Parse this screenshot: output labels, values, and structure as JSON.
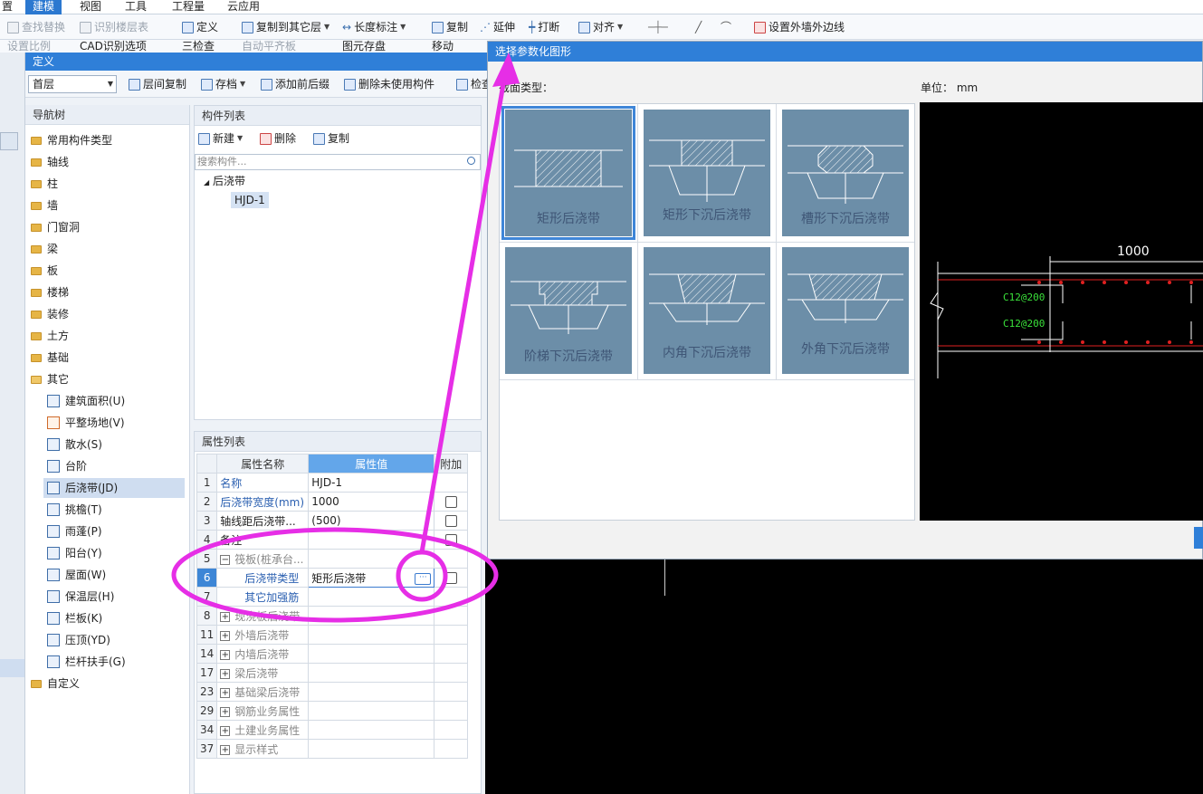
{
  "menu": {
    "items": [
      "置",
      "建模",
      "视图",
      "工具",
      "工程量",
      "云应用"
    ],
    "active": "建模"
  },
  "ribbon": {
    "find_replace": "查找替换",
    "recognize_floor_table": "识别楼层表",
    "define": "定义",
    "copy_to_other_floor": "复制到其它层",
    "length_dim": "长度标注",
    "copy": "复制",
    "extend": "延伸",
    "break": "打断",
    "align": "对齐",
    "set_outer_wall_edge": "设置外墙外边线",
    "row2_a": "设置比例",
    "row2_b": "CAD识别选项",
    "row2_c": "三检查",
    "row2_d": "自动平齐板",
    "row2_e": "图元存盘",
    "row2_f": "移动"
  },
  "define_window": {
    "title": "定义",
    "floor": "首层",
    "toolbar": {
      "floor_copy": "层间复制",
      "save": "存档",
      "add_prefix_suffix": "添加前后缀",
      "delete_unused": "删除未使用构件",
      "check": "检查"
    }
  },
  "nav_tree": {
    "title": "导航树",
    "folders": [
      "常用构件类型",
      "轴线",
      "柱",
      "墙",
      "门窗洞",
      "梁",
      "板",
      "楼梯",
      "装修",
      "土方",
      "基础",
      "其它"
    ],
    "other_children": [
      "建筑面积(U)",
      "平整场地(V)",
      "散水(S)",
      "台阶",
      "后浇带(JD)",
      "挑檐(T)",
      "雨蓬(P)",
      "阳台(Y)",
      "屋面(W)",
      "保温层(H)",
      "栏板(K)",
      "压顶(YD)",
      "栏杆扶手(G)"
    ],
    "selected": "后浇带(JD)",
    "custom": "自定义"
  },
  "component_list": {
    "title": "构件列表",
    "new": "新建",
    "delete": "删除",
    "copy": "复制",
    "search_placeholder": "搜索构件...",
    "group": "后浇带",
    "items": [
      "HJD-1"
    ]
  },
  "property_list": {
    "title": "属性列表",
    "headers": [
      "属性名称",
      "属性值",
      "附加"
    ],
    "rows": [
      {
        "num": "1",
        "name": "名称",
        "value": "HJD-1",
        "style": "blue",
        "check": false
      },
      {
        "num": "2",
        "name": "后浇带宽度(mm)",
        "value": "1000",
        "style": "blue",
        "check": true
      },
      {
        "num": "3",
        "name": "轴线距后浇带...",
        "value": "(500)",
        "style": "",
        "check": true
      },
      {
        "num": "4",
        "name": "备注",
        "value": "",
        "style": "",
        "check": true
      },
      {
        "num": "5",
        "name": "筏板(桩承台...",
        "value": "",
        "style": "gray-minus",
        "check": false
      },
      {
        "num": "6",
        "name": "后浇带类型",
        "value": "矩形后浇带",
        "style": "blue-indent",
        "check": true
      },
      {
        "num": "7",
        "name": "其它加强筋",
        "value": "",
        "style": "blue-indent",
        "check": false
      },
      {
        "num": "8",
        "name": "现浇板后浇带",
        "value": "",
        "style": "gray-plus",
        "check": false
      },
      {
        "num": "11",
        "name": "外墙后浇带",
        "value": "",
        "style": "gray-plus",
        "check": false
      },
      {
        "num": "14",
        "name": "内墙后浇带",
        "value": "",
        "style": "gray-plus",
        "check": false
      },
      {
        "num": "17",
        "name": "梁后浇带",
        "value": "",
        "style": "gray-plus",
        "check": false
      },
      {
        "num": "23",
        "name": "基础梁后浇带",
        "value": "",
        "style": "gray-plus",
        "check": false
      },
      {
        "num": "29",
        "name": "钢筋业务属性",
        "value": "",
        "style": "gray-plus",
        "check": false
      },
      {
        "num": "34",
        "name": "土建业务属性",
        "value": "",
        "style": "gray-plus",
        "check": false
      },
      {
        "num": "37",
        "name": "显示样式",
        "value": "",
        "style": "gray-plus",
        "check": false
      }
    ],
    "selected_row": "6"
  },
  "param_dialog": {
    "title": "选择参数化图形",
    "section_type_label": "截面类型：",
    "unit_label": "单位：",
    "unit_value": "mm",
    "shapes": [
      "矩形后浇带",
      "矩形下沉后浇带",
      "槽形下沉后浇带",
      "阶梯下沉后浇带",
      "内角下沉后浇带",
      "外角下沉后浇带"
    ],
    "selected_shape": "矩形后浇带",
    "preview": {
      "dimension": "1000",
      "rebar_top": "C12@200",
      "rebar_bottom": "C12@200"
    }
  },
  "annotation_color": "#e62ee6"
}
